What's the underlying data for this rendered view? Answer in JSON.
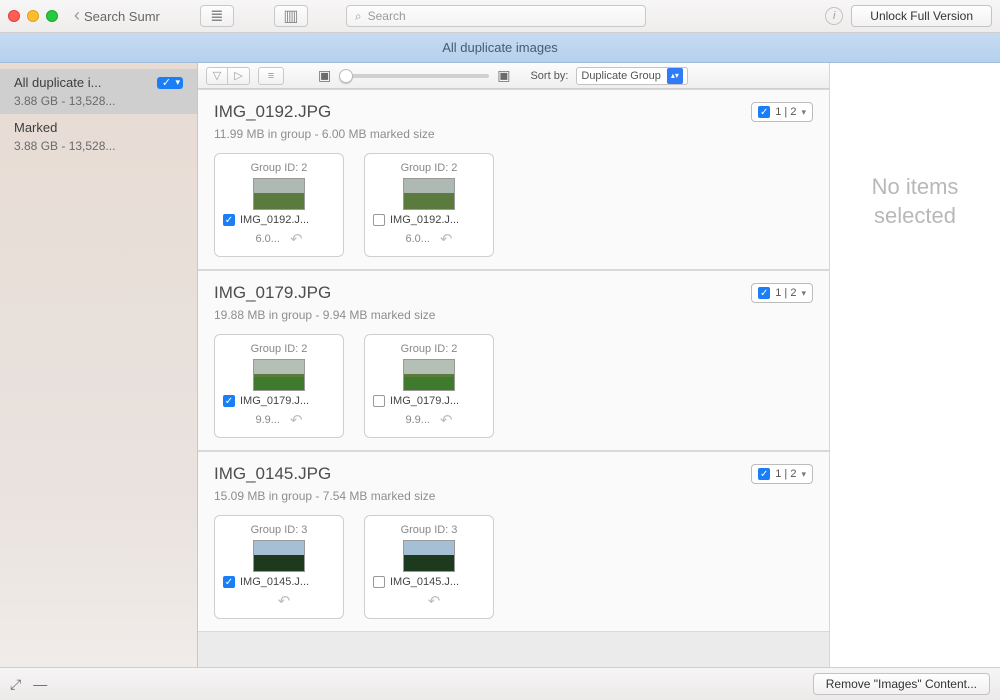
{
  "window": {
    "back_label": "Search Sumr",
    "search_placeholder": "Search",
    "unlock_label": "Unlock Full Version"
  },
  "bluebar": {
    "title": "All duplicate images"
  },
  "sidebar": {
    "items": [
      {
        "title": "All duplicate i...",
        "sub": "3.88 GB - 13,528...",
        "selected": true,
        "has_chip": true
      },
      {
        "title": "Marked",
        "sub": "3.88 GB - 13,528...",
        "selected": false,
        "has_chip": false
      }
    ]
  },
  "toolbar": {
    "sort_label": "Sort by:",
    "sort_value": "Duplicate Group"
  },
  "groups": [
    {
      "title": "IMG_0192.JPG",
      "sub": "11.99 MB in group - 6.00 MB marked size",
      "count": "1 | 2",
      "thumb_style": "sky",
      "cards": [
        {
          "gid": "Group ID: 2",
          "name": "IMG_0192.J...",
          "checked": true,
          "size": "6.0..."
        },
        {
          "gid": "Group ID: 2",
          "name": "IMG_0192.J...",
          "checked": false,
          "size": "6.0..."
        }
      ]
    },
    {
      "title": "IMG_0179.JPG",
      "sub": "19.88 MB in group - 9.94 MB marked size",
      "count": "1 | 2",
      "thumb_style": "grass",
      "cards": [
        {
          "gid": "Group ID: 2",
          "name": "IMG_0179.J...",
          "checked": true,
          "size": "9.9..."
        },
        {
          "gid": "Group ID: 2",
          "name": "IMG_0179.J...",
          "checked": false,
          "size": "9.9..."
        }
      ]
    },
    {
      "title": "IMG_0145.JPG",
      "sub": "15.09 MB in group - 7.54 MB marked size",
      "count": "1 | 2",
      "thumb_style": "trees",
      "cards": [
        {
          "gid": "Group ID: 3",
          "name": "IMG_0145.J...",
          "checked": true,
          "size": ""
        },
        {
          "gid": "Group ID: 3",
          "name": "IMG_0145.J...",
          "checked": false,
          "size": ""
        }
      ]
    }
  ],
  "detail": {
    "empty": "No items selected"
  },
  "bottom": {
    "remove_label": "Remove \"Images\" Content..."
  }
}
